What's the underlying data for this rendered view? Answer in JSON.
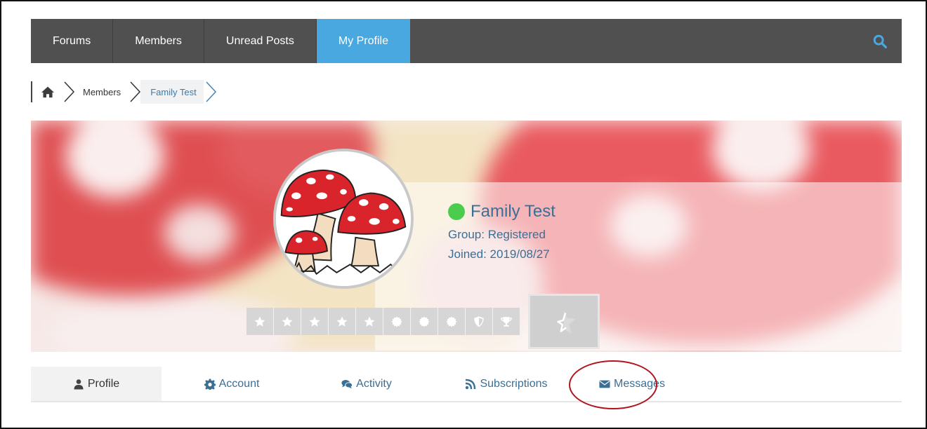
{
  "nav": {
    "items": [
      {
        "label": "Forums",
        "active": false
      },
      {
        "label": "Members",
        "active": false
      },
      {
        "label": "Unread Posts",
        "active": false
      },
      {
        "label": "My Profile",
        "active": true
      }
    ],
    "search_icon": "search-icon",
    "accent_color": "#4aa8e0"
  },
  "breadcrumb": {
    "home_icon": "home-icon",
    "items": [
      "Members",
      "Family Test"
    ]
  },
  "profile": {
    "name": "Family Test",
    "status": "online",
    "status_color": "#4ccc4c",
    "group": "Group: Registered",
    "joined": "Joined: 2019/08/27",
    "rank_icons": [
      "star",
      "star",
      "star",
      "star",
      "star",
      "badge",
      "badge",
      "badge",
      "shield",
      "trophy"
    ]
  },
  "tabs": [
    {
      "label": "Profile",
      "icon": "user-icon",
      "active": true
    },
    {
      "label": "Account",
      "icon": "gear-icon",
      "active": false
    },
    {
      "label": "Activity",
      "icon": "comments-icon",
      "active": false
    },
    {
      "label": "Subscriptions",
      "icon": "rss-icon",
      "active": false
    },
    {
      "label": "Messages",
      "icon": "envelope-icon",
      "active": false
    }
  ]
}
